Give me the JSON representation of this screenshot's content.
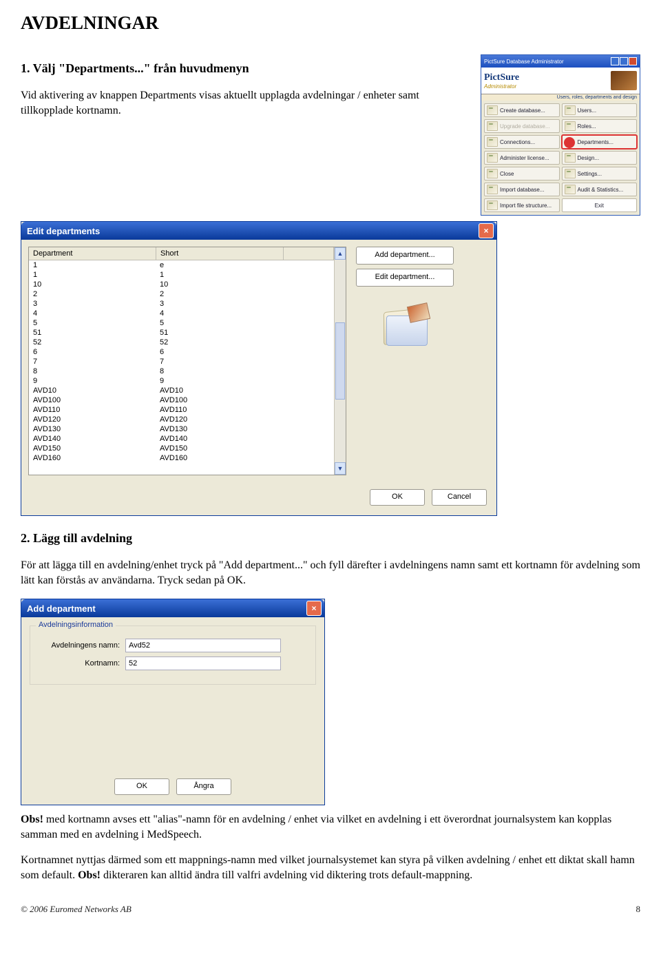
{
  "heading": "AVDELNINGAR",
  "step1": {
    "title": "1. Välj \"Departments...\" från huvudmenyn",
    "text": "Vid aktivering av knappen Departments visas aktuellt upplagda avdelningar / enheter samt tillkopplade kortnamn."
  },
  "admin": {
    "title": "PictSure Database Administrator",
    "brand": "PictSure",
    "admin_label": "Administrator",
    "hint": "Users, roles, departments and design",
    "buttons_left": [
      "Create database...",
      "Upgrade database...",
      "Connections...",
      "Administer license...",
      "Close",
      "Import database...",
      "Import file structure..."
    ],
    "buttons_right": [
      "Users...",
      "Roles...",
      "Departments...",
      "Design...",
      "Settings...",
      "Audit & Statistics..."
    ],
    "exit": "Exit"
  },
  "edit_win": {
    "title": "Edit departments",
    "columns": [
      "Department",
      "Short"
    ],
    "rows": [
      [
        "1",
        "e"
      ],
      [
        "1",
        "1"
      ],
      [
        "10",
        "10"
      ],
      [
        "2",
        "2"
      ],
      [
        "3",
        "3"
      ],
      [
        "4",
        "4"
      ],
      [
        "5",
        "5"
      ],
      [
        "51",
        "51"
      ],
      [
        "52",
        "52"
      ],
      [
        "6",
        "6"
      ],
      [
        "7",
        "7"
      ],
      [
        "8",
        "8"
      ],
      [
        "9",
        "9"
      ],
      [
        "AVD10",
        "AVD10"
      ],
      [
        "AVD100",
        "AVD100"
      ],
      [
        "AVD110",
        "AVD110"
      ],
      [
        "AVD120",
        "AVD120"
      ],
      [
        "AVD130",
        "AVD130"
      ],
      [
        "AVD140",
        "AVD140"
      ],
      [
        "AVD150",
        "AVD150"
      ],
      [
        "AVD160",
        "AVD160"
      ]
    ],
    "add_btn": "Add department...",
    "edit_btn": "Edit department...",
    "ok": "OK",
    "cancel": "Cancel"
  },
  "step2": {
    "title": "2. Lägg till avdelning",
    "text": "För att lägga till en avdelning/enhet tryck på \"Add department...\" och fyll därefter i avdelningens namn samt ett kortnamn för avdelning som lätt kan förstås av användarna. Tryck sedan på OK."
  },
  "add_win": {
    "title": "Add department",
    "legend": "Avdelningsinformation",
    "name_lbl": "Avdelningens namn:",
    "name_val": "Avd52",
    "short_lbl": "Kortnamn:",
    "short_val": "52",
    "ok": "OK",
    "cancel": "Ångra"
  },
  "note1": {
    "bold": "Obs!",
    "text": " med kortnamn avses ett \"alias\"-namn för en avdelning / enhet via vilket en avdelning i ett överordnat journalsystem kan kopplas samman med en avdelning i MedSpeech."
  },
  "note2": {
    "text1": "Kortnamnet nyttjas därmed som ett mappnings-namn med vilket journalsystemet kan styra på vilken avdelning / enhet ett diktat skall hamn som default. ",
    "bold": "Obs!",
    "text2": " dikteraren kan alltid ändra till valfri avdelning vid diktering trots default-mappning."
  },
  "footer": {
    "copyright": "© 2006 Euromed Networks AB",
    "page": "8"
  }
}
